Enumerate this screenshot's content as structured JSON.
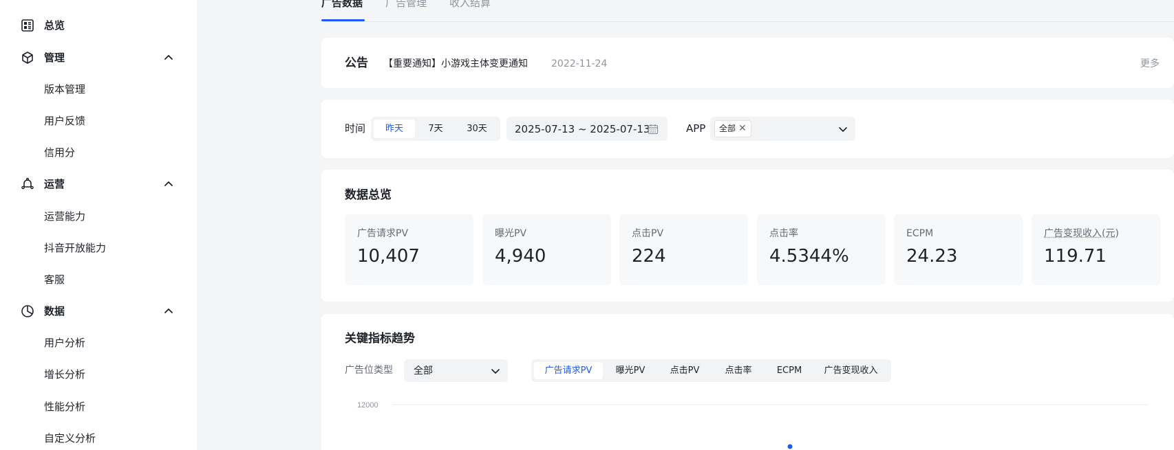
{
  "sidebar": {
    "overview": "总览",
    "manage": {
      "label": "管理",
      "items": [
        "版本管理",
        "用户反馈",
        "信用分"
      ]
    },
    "operations": {
      "label": "运营",
      "items": [
        "运营能力",
        "抖音开放能力",
        "客服"
      ]
    },
    "data": {
      "label": "数据",
      "items": [
        "用户分析",
        "增长分析",
        "性能分析",
        "自定义分析"
      ]
    }
  },
  "top_tabs": [
    "广告数据",
    "广告管理",
    "收入结算"
  ],
  "notice": {
    "title": "公告",
    "text": "【重要通知】小游戏主体变更通知",
    "date": "2022-11-24",
    "more": "更多"
  },
  "filters": {
    "time_label": "时间",
    "time_options": [
      "昨天",
      "7天",
      "30天"
    ],
    "date_range": "2025-07-13 ~ 2025-07-13",
    "app_label": "APP",
    "app_tag": "全部"
  },
  "overview": {
    "title": "数据总览",
    "metrics": [
      {
        "label": "广告请求PV",
        "value": "10,407"
      },
      {
        "label": "曝光PV",
        "value": "4,940"
      },
      {
        "label": "点击PV",
        "value": "224"
      },
      {
        "label": "点击率",
        "value": "4.5344%"
      },
      {
        "label": "ECPM",
        "value": "24.23"
      },
      {
        "label": "广告变现收入(元)",
        "value": "119.71"
      }
    ]
  },
  "trend": {
    "title": "关键指标趋势",
    "ad_type_label": "广告位类型",
    "ad_type_value": "全部",
    "metric_tabs": [
      "广告请求PV",
      "曝光PV",
      "点击PV",
      "点击率",
      "ECPM",
      "广告变现收入"
    ]
  },
  "chart_data": {
    "type": "line",
    "ytick_labels": [
      "12000"
    ]
  },
  "colors": {
    "accent": "#1e5bf6",
    "text": "#1f2329",
    "muted": "#8f959e",
    "background": "#f4f5f7"
  },
  "icons": {
    "overview": "dashboard-icon",
    "manage": "cube-icon",
    "operations": "bell-icon",
    "data": "pie-chart-icon"
  }
}
